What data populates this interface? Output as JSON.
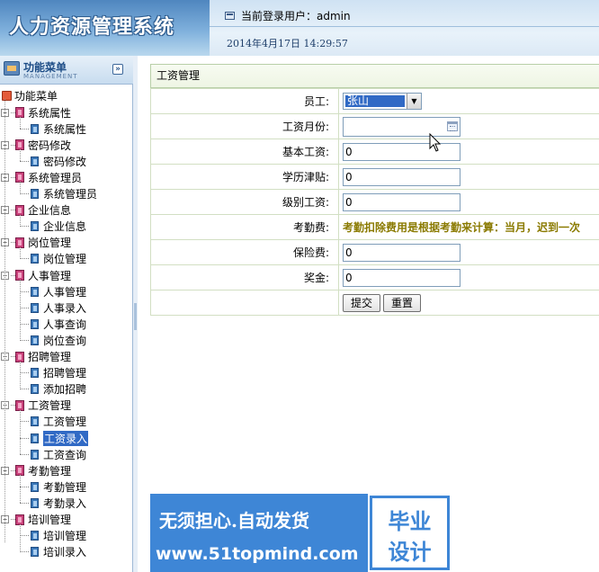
{
  "header": {
    "app_title": "人力资源管理系统",
    "user_label": "当前登录用户：admin",
    "datetime": "2014年4月17日  14:29:57"
  },
  "sidebar": {
    "menu_title": "功能菜单",
    "menu_subtitle": "MANAGEMENT",
    "toggle_glyph": "»",
    "root_label": "功能菜单",
    "groups": [
      {
        "label": "系统属性",
        "items": [
          "系统属性"
        ]
      },
      {
        "label": "密码修改",
        "items": [
          "密码修改"
        ]
      },
      {
        "label": "系统管理员",
        "items": [
          "系统管理员"
        ]
      },
      {
        "label": "企业信息",
        "items": [
          "企业信息"
        ]
      },
      {
        "label": "岗位管理",
        "items": [
          "岗位管理"
        ]
      },
      {
        "label": "人事管理",
        "items": [
          "人事管理",
          "人事录入",
          "人事查询",
          "岗位查询"
        ]
      },
      {
        "label": "招聘管理",
        "items": [
          "招聘管理",
          "添加招聘"
        ]
      },
      {
        "label": "工资管理",
        "items": [
          "工资管理",
          "工资录入",
          "工资查询"
        ]
      },
      {
        "label": "考勤管理",
        "items": [
          "考勤管理",
          "考勤录入"
        ]
      },
      {
        "label": "培训管理",
        "items": [
          "培训管理",
          "培训录入"
        ]
      }
    ],
    "active_item": "工资录入"
  },
  "form": {
    "panel_title": "工资管理",
    "employee_label": "员工:",
    "employee_value": "张山",
    "month_label": "工资月份:",
    "month_value": "",
    "base_label": "基本工资:",
    "base_value": "0",
    "edu_label": "学历津贴:",
    "edu_value": "0",
    "level_label": "级别工资:",
    "level_value": "0",
    "attendance_label": "考勤费:",
    "attendance_note": "考勤扣除费用是根据考勤来计算：当月，迟到一次",
    "insurance_label": "保险费:",
    "insurance_value": "0",
    "bonus_label": "奖金:",
    "bonus_value": "0",
    "submit_label": "提交",
    "reset_label": "重置"
  },
  "ad": {
    "line1": "无须担心.自动发货",
    "line2": "www.51topmind.com",
    "right1": "毕业",
    "right2": "设计"
  },
  "colors": {
    "header_blue": "#4f86bf",
    "selection": "#316ac5",
    "attendance_note": "#8a7a00",
    "ad_blue": "#3e86d6"
  }
}
